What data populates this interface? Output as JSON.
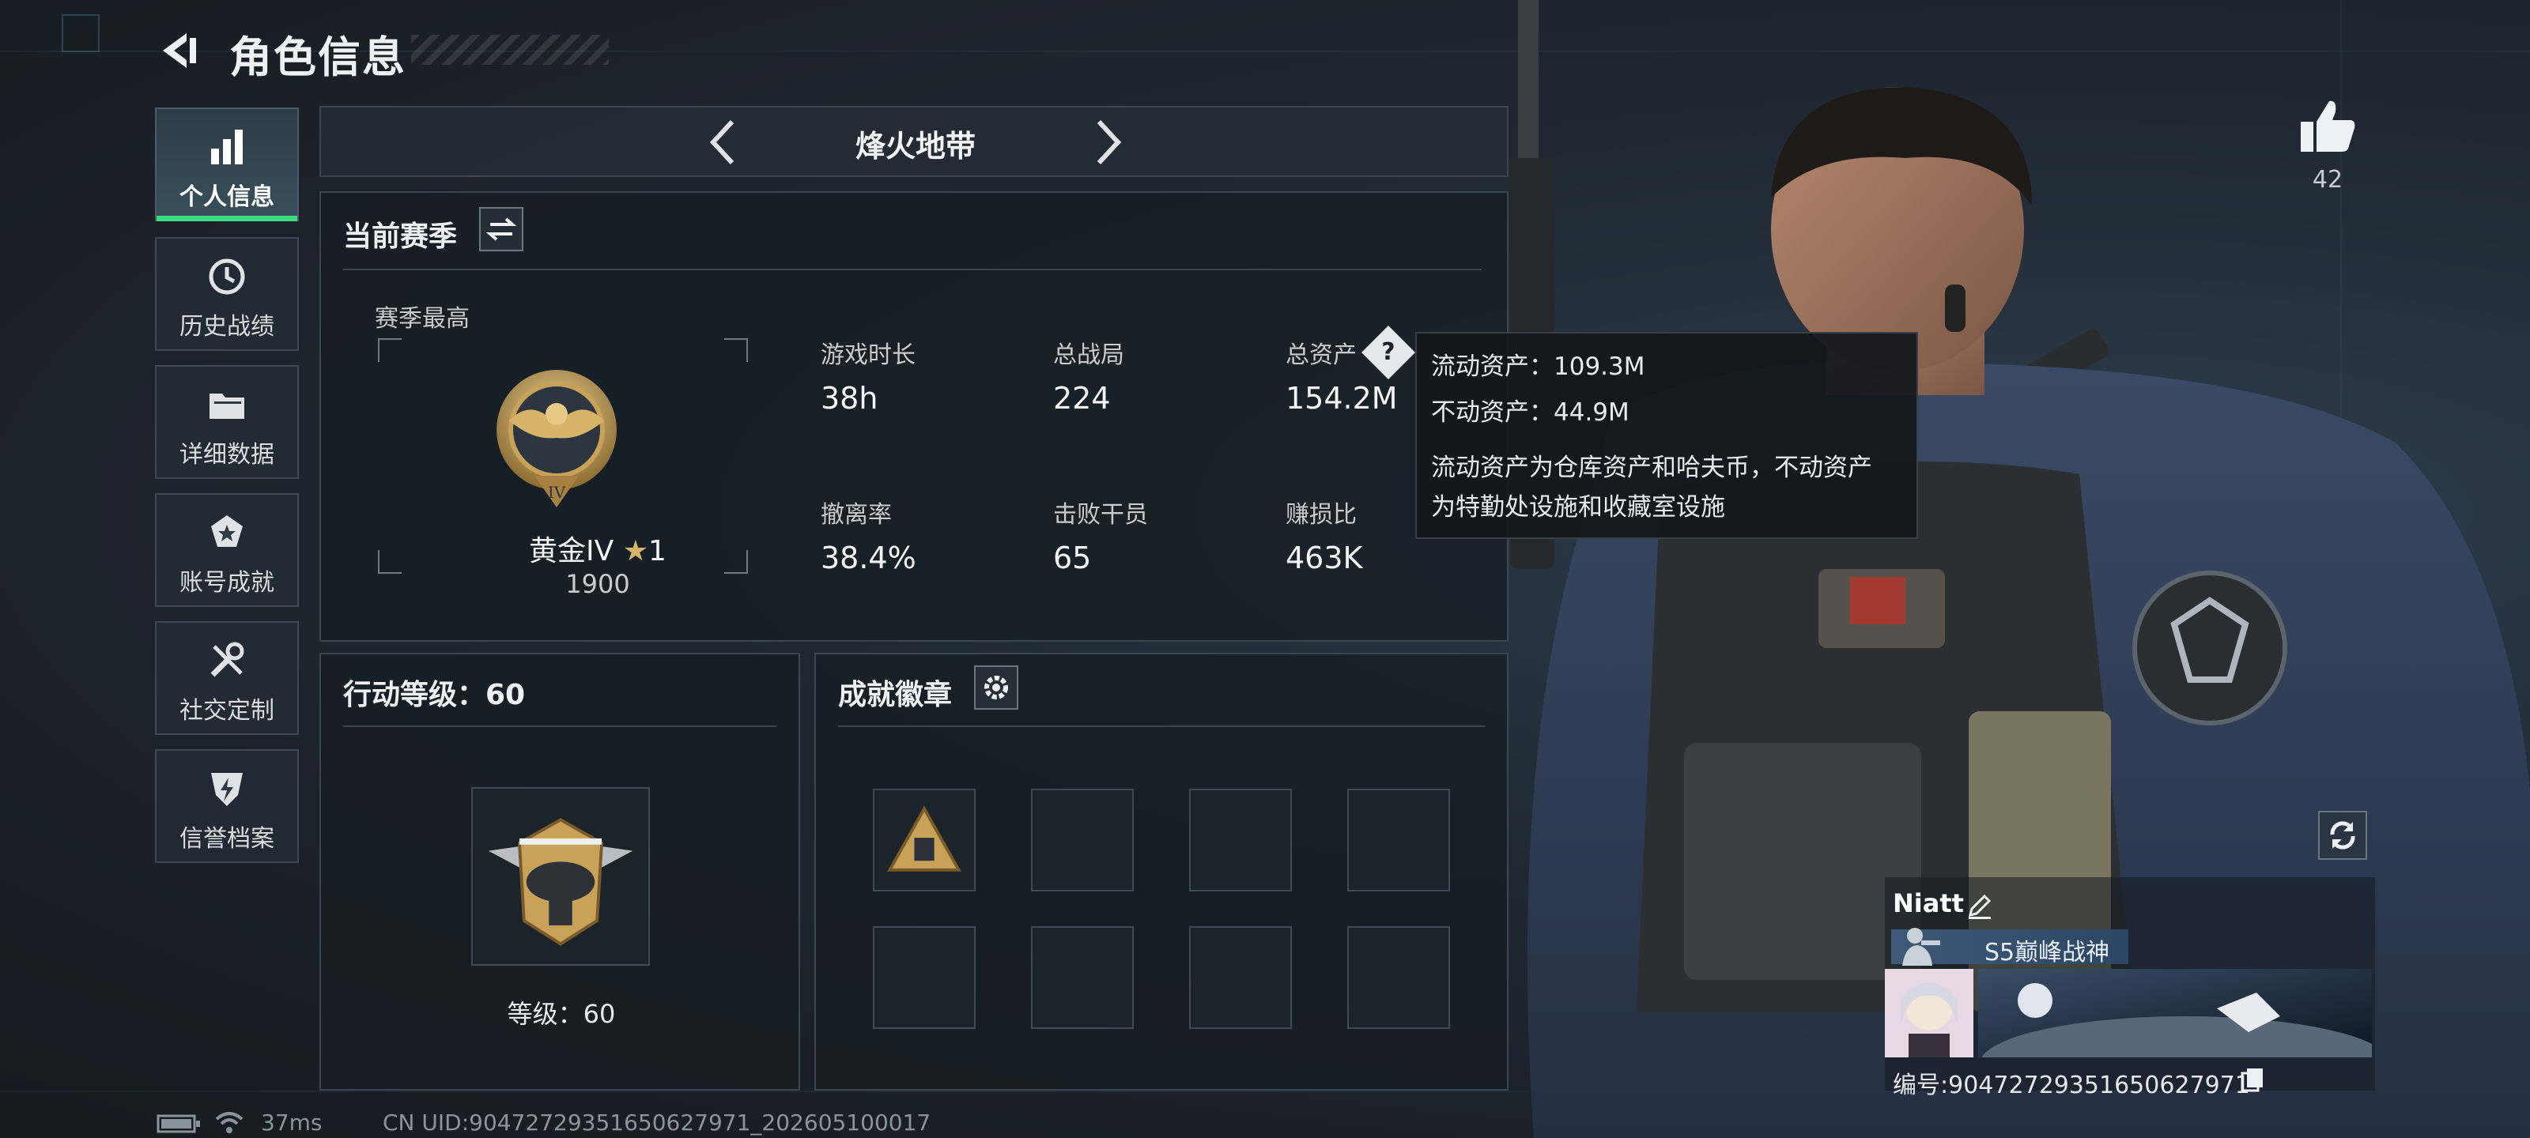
{
  "header": {
    "title": "角色信息"
  },
  "nav": [
    {
      "label": "个人信息",
      "icon": "bar-chart-icon",
      "active": true
    },
    {
      "label": "历史战绩",
      "icon": "history-clock-icon",
      "active": false
    },
    {
      "label": "详细数据",
      "icon": "folder-icon",
      "active": false
    },
    {
      "label": "账号成就",
      "icon": "achievement-star-icon",
      "active": false
    },
    {
      "label": "社交定制",
      "icon": "tools-icon",
      "active": false
    },
    {
      "label": "信誉档案",
      "icon": "shield-lightning-icon",
      "active": false
    }
  ],
  "mode": {
    "title": "烽火地带"
  },
  "season": {
    "title": "当前赛季",
    "best_label": "赛季最高",
    "rank_name": "黄金IV",
    "rank_stars": "1",
    "rank_points": "1900",
    "rank_badge_numeral": "IV",
    "stats": [
      {
        "label": "游戏时长",
        "value": "38h"
      },
      {
        "label": "总战局",
        "value": "224"
      },
      {
        "label": "总资产",
        "value": "154.2M"
      },
      {
        "label": "撤离率",
        "value": "38.4%"
      },
      {
        "label": "击败干员",
        "value": "65"
      },
      {
        "label": "赚损比",
        "value": "463K"
      }
    ]
  },
  "tooltip": {
    "liquid": "流动资产：109.3M",
    "fixed": "不动资产：44.9M",
    "desc_line1": "流动资产为仓库资产和哈夫币，不动资产",
    "desc_line2": "为特勤处设施和收藏室设施"
  },
  "level": {
    "title": "行动等级：60",
    "label": "等级：60"
  },
  "achievements": {
    "title": "成就徽章",
    "slots": 8,
    "filled": 1
  },
  "likes": {
    "count": "42"
  },
  "profile": {
    "name": "Niatt",
    "rank_title": "S5巅峰战神",
    "id_text": "编号:9047272935165062797​1"
  },
  "footer": {
    "ping": "37ms",
    "uid": "CN UID:9047272935165062797​1_202605100017"
  },
  "colors": {
    "accent_green": "#3ddc84",
    "gold": "#c9a25a",
    "panel_bg": "#161d24"
  }
}
